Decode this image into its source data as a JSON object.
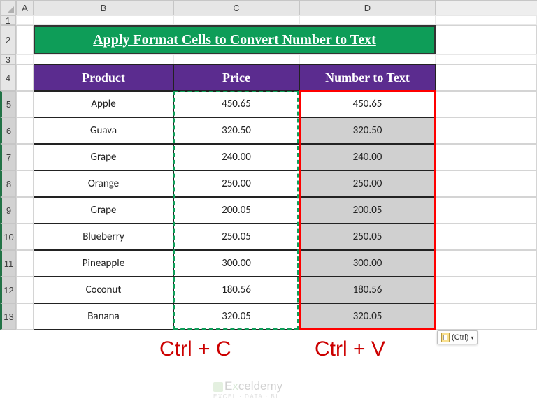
{
  "columns": [
    "A",
    "B",
    "C",
    "D"
  ],
  "rows": [
    "1",
    "2",
    "3",
    "4",
    "5",
    "6",
    "7",
    "8",
    "9",
    "10",
    "11",
    "12",
    "13"
  ],
  "title": "Apply Format Cells to Convert Number to Text",
  "headers": {
    "product": "Product",
    "price": "Price",
    "n2t": "Number to Text"
  },
  "data": [
    {
      "product": "Apple",
      "price": "450.65",
      "n2t": "450.65"
    },
    {
      "product": "Guava",
      "price": "320.50",
      "n2t": "320.50"
    },
    {
      "product": "Grape",
      "price": "240.00",
      "n2t": "240.00"
    },
    {
      "product": "Orange",
      "price": "250.00",
      "n2t": "250.00"
    },
    {
      "product": "Grape",
      "price": "200.05",
      "n2t": "200.05"
    },
    {
      "product": "Blueberry",
      "price": "250.05",
      "n2t": "250.05"
    },
    {
      "product": "Pineapple",
      "price": "300.00",
      "n2t": "300.00"
    },
    {
      "product": "Coconut",
      "price": "180.56",
      "n2t": "180.56"
    },
    {
      "product": "Banana",
      "price": "320.05",
      "n2t": "320.05"
    }
  ],
  "shortcuts": {
    "copy": "Ctrl + C",
    "paste": "Ctrl + V"
  },
  "paste_tag": "(Ctrl)",
  "watermark": {
    "main": "Exceldemy",
    "sub": "EXCEL · DATA · BI"
  },
  "chart_data": {
    "type": "table",
    "title": "Apply Format Cells to Convert Number to Text",
    "columns": [
      "Product",
      "Price",
      "Number to Text"
    ],
    "rows": [
      [
        "Apple",
        "450.65",
        "450.65"
      ],
      [
        "Guava",
        "320.50",
        "320.50"
      ],
      [
        "Grape",
        "240.00",
        "240.00"
      ],
      [
        "Orange",
        "250.00",
        "250.00"
      ],
      [
        "Grape",
        "200.05",
        "200.05"
      ],
      [
        "Blueberry",
        "250.05",
        "250.05"
      ],
      [
        "Pineapple",
        "300.00",
        "300.00"
      ],
      [
        "Coconut",
        "180.56",
        "180.56"
      ],
      [
        "Banana",
        "320.05",
        "320.05"
      ]
    ]
  }
}
